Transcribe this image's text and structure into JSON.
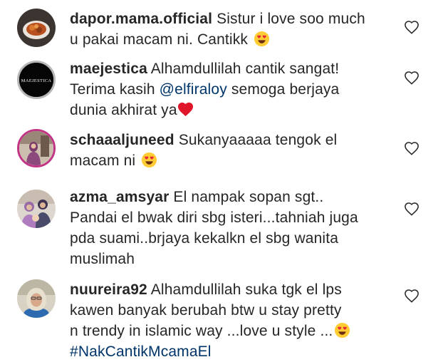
{
  "comments": [
    {
      "username": "dapor.mama.official",
      "lines": [
        "Sistur i love soo much",
        "u pakai macam ni. Cantikk"
      ],
      "emoji": "heart-eyes"
    },
    {
      "username": "maejestica",
      "avatar_text": "MAEJESTICA",
      "lines": [
        "Alhamdullilah cantik sangat!",
        "Terima kasih",
        "semoga berjaya",
        "dunia akhirat ya"
      ],
      "mention": "@elfiraloy",
      "emoji": "red-heart"
    },
    {
      "username": "schaaaljuneed",
      "lines": [
        "Sukanyaaaaa tengok el",
        "macam ni"
      ],
      "emoji": "heart-eyes"
    },
    {
      "username": "azma_amsyar",
      "lines": [
        "El nampak sopan sgt..",
        "Pandai el bwak diri sbg isteri...tahniah juga",
        "pda suami..brjaya kekalkn el sbg wanita",
        "muslimah"
      ]
    },
    {
      "username": "nuureira92",
      "lines": [
        "Alhamdullilah suka tgk el lps",
        "kawen banyak berubah btw u stay pretty",
        "n trendy in islamic way ...love u style ..."
      ],
      "hashtag": "#NakCantikMcamaEl",
      "emoji": "heart-eyes"
    }
  ],
  "colors": {
    "text": "#262626",
    "link": "#003569",
    "like_icon": "#262626"
  }
}
